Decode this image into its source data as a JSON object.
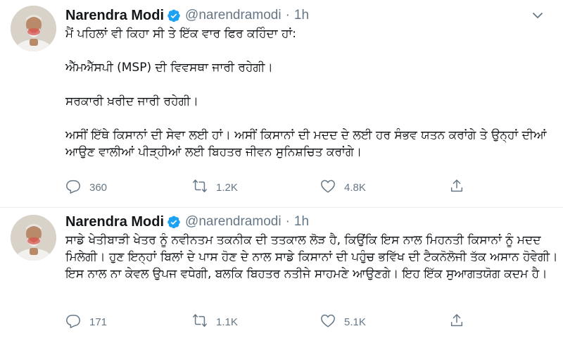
{
  "tweets": [
    {
      "author_name": "Narendra Modi",
      "handle": "@narendramodi",
      "separator": "·",
      "time": "1h",
      "paragraphs": [
        "ਮੈਂ ਪਹਿਲਾਂ ਵੀ ਕਿਹਾ ਸੀ ਤੇ ਇੱਕ ਵਾਰ ਫਿਰ ਕਹਿੰਦਾ ਹਾਂ:",
        "ਐੱਮਐੱਸਪੀ (MSP) ਦੀ ਵਿਵਸਥਾ ਜਾਰੀ ਰਹੇਗੀ।",
        "ਸਰਕਾਰੀ ਖ਼ਰੀਦ ਜਾਰੀ ਰਹੇਗੀ।",
        "ਅਸੀਂ ਇੱਥੇ ਕਿਸਾਨਾਂ ਦੀ ਸੇਵਾ ਲਈ ਹਾਂ। ਅਸੀਂ ਕਿਸਾਨਾਂ ਦੀ ਮਦਦ ਦੇ ਲਈ ਹਰ ਸੰਭਵ ਯਤਨ ਕਰਾਂਗੇ ਤੇ ਉਨ੍ਹਾਂ ਦੀਆਂ ਆਉਣ ਵਾਲੀਆਂ ਪੀੜ੍ਹੀਆਂ ਲਈ ਬਿਹਤਰ ਜੀਵਨ ਸੁਨਿਸ਼ਚਿਤ ਕਰਾਂਗੇ।"
      ],
      "replies": "360",
      "retweets": "1.2K",
      "likes": "4.8K"
    },
    {
      "author_name": "Narendra Modi",
      "handle": "@narendramodi",
      "separator": "·",
      "time": "1h",
      "paragraphs": [
        "ਸਾਡੇ ਖੇਤੀਬਾੜੀ ਖੇਤਰ ਨੂੰ ਨਵੀਨਤਮ ਤਕਨੀਕ ਦੀ ਤਤਕਾਲ ਲੋੜ ਹੈ, ਕਿਉਂਕਿ ਇਸ ਨਾਲ ਮਿਹਨਤੀ ਕਿਸਾਨਾਂ ਨੂੰ ਮਦਦ ਮਿਲੇਗੀ। ਹੁਣ ਇਨ੍ਹਾਂ ਬਿਲਾਂ ਦੇ ਪਾਸ ਹੋਣ ਦੇ ਨਾਲ ਸਾਡੇ ਕਿਸਾਨਾਂ ਦੀ ਪਹੁੰਚ ਭਵਿੱਖ ਦੀ ਟੈਕਨੋਲੋਜੀ ਤੱਕ ਅਸਾਨ ਹੋਵੇਗੀ। ਇਸ ਨਾਲ ਨਾ ਕੇਵਲ ਉਪਜ ਵਧੇਗੀ, ਬਲਕਿ ਬਿਹਤਰ ਨਤੀਜੇ ਸਾਹਮਣੇ ਆਉਣਗੇ। ਇਹ ਇੱਕ ਸੁਆਗਤਯੋਗ ਕਦਮ ਹੈ।"
      ],
      "replies": "171",
      "retweets": "1.1K",
      "likes": "5.1K"
    }
  ],
  "icons": {
    "verified": "verified-badge-icon",
    "chevron": "chevron-down-icon",
    "reply": "reply-icon",
    "retweet": "retweet-icon",
    "like": "heart-icon",
    "share": "share-icon"
  },
  "colors": {
    "verified_blue": "#1da1f2",
    "text": "#14171a",
    "secondary": "#657786",
    "border": "#e6ecf0"
  }
}
